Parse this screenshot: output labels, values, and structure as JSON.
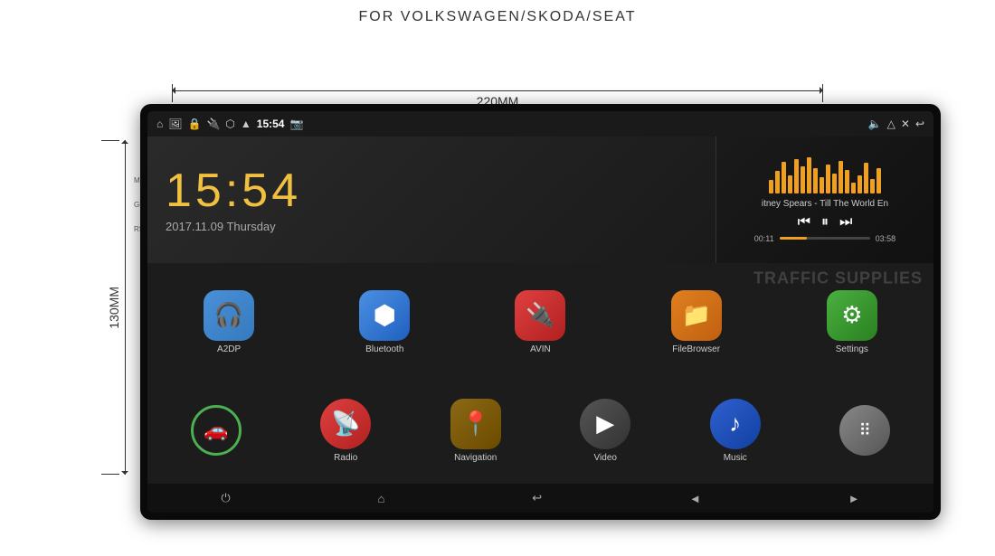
{
  "page": {
    "title": "FOR VOLKSWAGEN/SKODA/SEAT",
    "dim_width": "220MM",
    "dim_height": "130MM"
  },
  "status_bar": {
    "time": "15:54",
    "icons_left": [
      "home",
      "image",
      "lock",
      "usb"
    ],
    "icons_right": [
      "bluetooth",
      "wifi",
      "camera",
      "volume",
      "eject",
      "close",
      "back"
    ]
  },
  "clock": {
    "time": "15:54",
    "date": "2017.11.09 Thursday"
  },
  "music": {
    "title": "itney Spears - Till The World En",
    "time_current": "00:11",
    "time_total": "03:58",
    "progress_pct": 30
  },
  "apps_row1": [
    {
      "id": "a2dp",
      "label": "A2DP",
      "icon": "🎧",
      "color_class": "icon-a2dp"
    },
    {
      "id": "bluetooth",
      "label": "Bluetooth",
      "icon": "⬡",
      "color_class": "icon-bluetooth"
    },
    {
      "id": "avin",
      "label": "AVIN",
      "icon": "🔌",
      "color_class": "icon-avin"
    },
    {
      "id": "filebrowser",
      "label": "FileBrowser",
      "icon": "📁",
      "color_class": "icon-filebrowser"
    },
    {
      "id": "settings",
      "label": "Settings",
      "icon": "⚙",
      "color_class": "icon-settings"
    }
  ],
  "apps_row2": [
    {
      "id": "car",
      "label": "",
      "icon": "🚗",
      "type": "circle-outline"
    },
    {
      "id": "radio",
      "label": "Radio",
      "icon": "📡",
      "color_class": "icon-radio"
    },
    {
      "id": "navigation",
      "label": "Navigation",
      "icon": "📍",
      "color_class": "icon-nav"
    },
    {
      "id": "video",
      "label": "Video",
      "icon": "▶",
      "color_class": "icon-video"
    },
    {
      "id": "music",
      "label": "Music",
      "icon": "♪",
      "color_class": "icon-music"
    },
    {
      "id": "more",
      "label": "",
      "icon": "⠿",
      "type": "circle"
    }
  ],
  "bottom_nav": {
    "icons": [
      "⏻",
      "⌂",
      "↩",
      "◄",
      "►"
    ]
  },
  "side_labels": [
    "MIC",
    "GPS",
    "RST"
  ],
  "watermark": "TRAFFIC SUPPLIES"
}
